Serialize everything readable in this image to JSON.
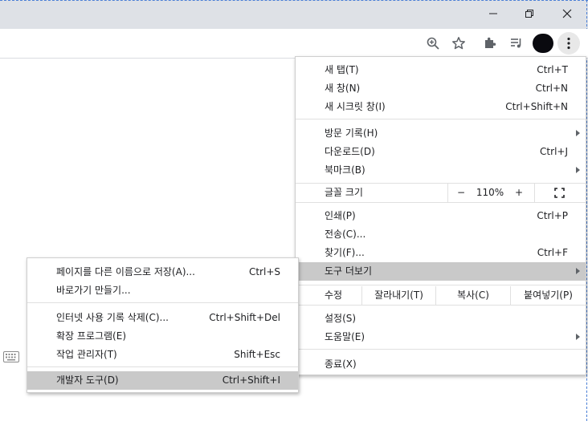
{
  "colors": {
    "titlebar": "#dee1e6",
    "highlight": "#c9c9c9",
    "menu_bg": "#ffffff",
    "text": "#202124"
  },
  "window_controls": {
    "minimize": "minimize-icon",
    "restore": "restore-icon",
    "close": "close-icon"
  },
  "toolbar_icons": [
    "zoom-icon",
    "star-icon",
    "extensions-puzzle-icon",
    "media-playlist-icon",
    "profile-avatar",
    "more-vert-icon"
  ],
  "main_menu": {
    "new_tab": {
      "label": "새 탭(T)",
      "shortcut": "Ctrl+T"
    },
    "new_window": {
      "label": "새 창(N)",
      "shortcut": "Ctrl+N"
    },
    "new_incognito": {
      "label": "새 시크릿 창(I)",
      "shortcut": "Ctrl+Shift+N"
    },
    "history": {
      "label": "방문 기록(H)"
    },
    "downloads": {
      "label": "다운로드(D)",
      "shortcut": "Ctrl+J"
    },
    "bookmarks": {
      "label": "북마크(B)"
    },
    "zoom": {
      "label": "글꼴 크기",
      "minus": "−",
      "value": "110%",
      "plus": "+"
    },
    "print": {
      "label": "인쇄(P)",
      "shortcut": "Ctrl+P"
    },
    "cast": {
      "label": "전송(C)..."
    },
    "find": {
      "label": "찾기(F)...",
      "shortcut": "Ctrl+F"
    },
    "more_tools": {
      "label": "도구 더보기"
    },
    "edit": {
      "label": "수정",
      "cut": "잘라내기(T)",
      "copy": "복사(C)",
      "paste": "붙여넣기(P)"
    },
    "settings": {
      "label": "설정(S)"
    },
    "help": {
      "label": "도움말(E)"
    },
    "exit": {
      "label": "종료(X)"
    }
  },
  "submenu": {
    "save_as": {
      "label": "페이지를 다른 이름으로 저장(A)...",
      "shortcut": "Ctrl+S"
    },
    "create_shortcut": {
      "label": "바로가기 만들기..."
    },
    "clear_data": {
      "label": "인터넷 사용 기록 삭제(C)...",
      "shortcut": "Ctrl+Shift+Del"
    },
    "extensions": {
      "label": "확장 프로그램(E)"
    },
    "task_manager": {
      "label": "작업 관리자(T)",
      "shortcut": "Shift+Esc"
    },
    "dev_tools": {
      "label": "개발자 도구(D)",
      "shortcut": "Ctrl+Shift+I"
    }
  },
  "page_icons": [
    "keyboard-icon"
  ]
}
